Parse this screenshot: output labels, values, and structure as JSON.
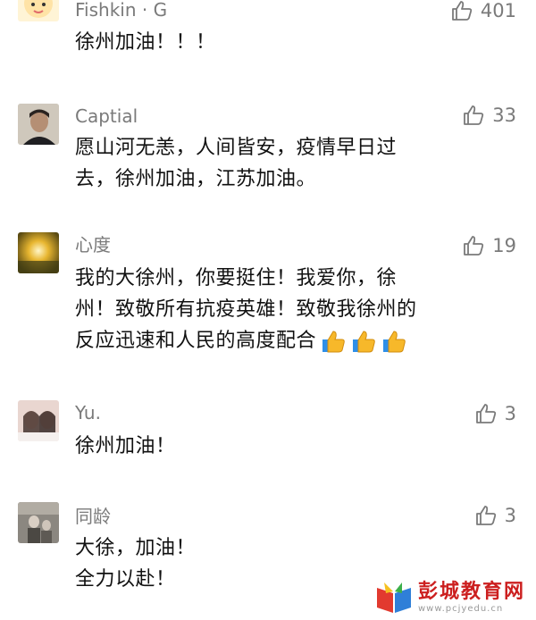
{
  "comments": [
    {
      "username": "Fishkin · G",
      "likes": "401",
      "lines": [
        "徐州加油！！！"
      ]
    },
    {
      "username": "Captial",
      "likes": "33",
      "lines": [
        "愿山河无恙，人间皆安，疫情早日过",
        "去，徐州加油，江苏加油。"
      ]
    },
    {
      "username": "心度",
      "likes": "19",
      "lines": [
        "我的大徐州，你要挺住！我爱你，徐",
        "州！致敬所有抗疫英雄！致敬我徐州的",
        "反应迅速和人民的高度配合"
      ]
    },
    {
      "username": "Yu.",
      "likes": "3",
      "lines": [
        "徐州加油！"
      ]
    },
    {
      "username": "同龄",
      "likes": "3",
      "lines": [
        "大徐，加油！",
        "全力以赴！"
      ]
    }
  ],
  "emoji": "thumbs-up-icon",
  "watermark": {
    "title": "彭城教育网",
    "url": "www.pcjyedu.cn"
  },
  "colors": {
    "username": "#7a7a7a",
    "text": "#111111",
    "watermark": "#cc1f1f"
  }
}
